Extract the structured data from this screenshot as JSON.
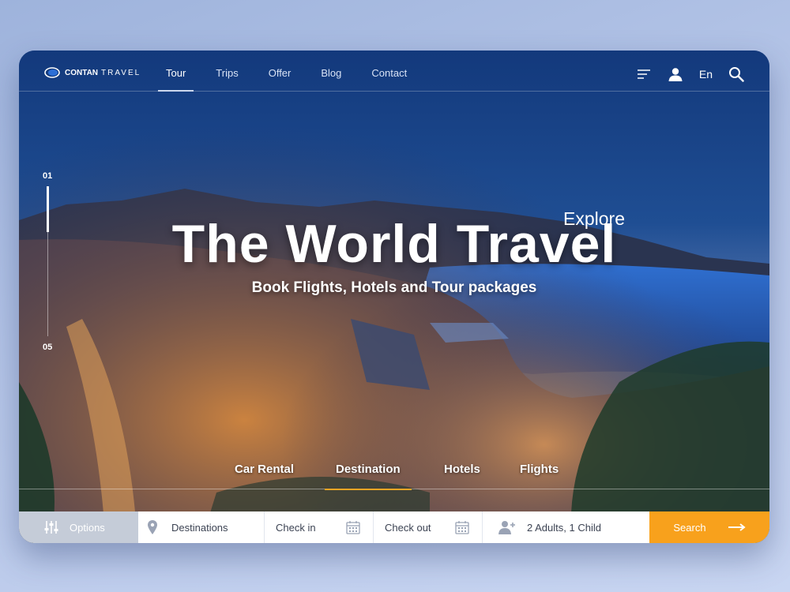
{
  "brand": {
    "name_bold": "CONTAN",
    "name_rest": "TRAVEL"
  },
  "nav": {
    "items": [
      {
        "label": "Tour",
        "active": true
      },
      {
        "label": "Trips",
        "active": false
      },
      {
        "label": "Offer",
        "active": false
      },
      {
        "label": "Blog",
        "active": false
      },
      {
        "label": "Contact",
        "active": false
      }
    ],
    "language": "En",
    "icons": [
      "menu-icon",
      "user-icon",
      "search-icon"
    ]
  },
  "slider": {
    "current": "01",
    "total": "05"
  },
  "hero": {
    "kicker": "Explore",
    "headline": "The World Travel",
    "subheadline": "Book Flights, Hotels and Tour packages"
  },
  "tabs": [
    {
      "label": "Car Rental",
      "active": false
    },
    {
      "label": "Destination",
      "active": true
    },
    {
      "label": "Hotels",
      "active": false
    },
    {
      "label": "Flights",
      "active": false
    }
  ],
  "search_bar": {
    "options_label": "Options",
    "destinations_label": "Destinations",
    "check_in_label": "Check in",
    "check_out_label": "Check out",
    "guests_label": "2 Adults, 1 Child",
    "search_label": "Search"
  },
  "colors": {
    "accent": "#f8a11c",
    "nav_blue": "#123a7a",
    "options_gray": "#c5ccd8",
    "tab_underline": "#f5a524"
  }
}
